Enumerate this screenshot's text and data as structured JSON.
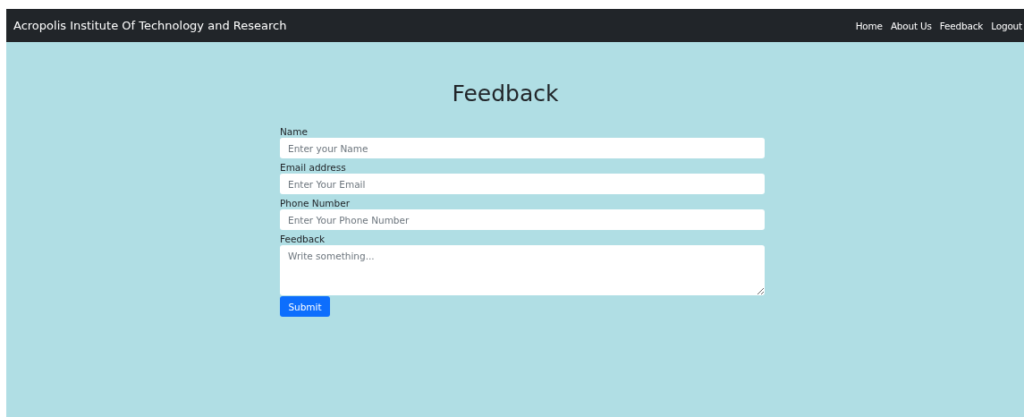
{
  "navbar": {
    "brand": "Acropolis Institute Of Technology and Research",
    "links": [
      "Home",
      "About Us",
      "Feedback",
      "Logout"
    ]
  },
  "heading": "Feedback",
  "fields": [
    {
      "label": "Name",
      "placeholder": "Enter your Name",
      "kind": "input"
    },
    {
      "label": "Email address",
      "placeholder": "Enter Your Email",
      "kind": "input"
    },
    {
      "label": "Phone Number",
      "placeholder": "Enter Your Phone Number",
      "kind": "input"
    },
    {
      "label": "Feedback",
      "placeholder": "Write something...",
      "kind": "textarea"
    }
  ],
  "submit": "Submit"
}
